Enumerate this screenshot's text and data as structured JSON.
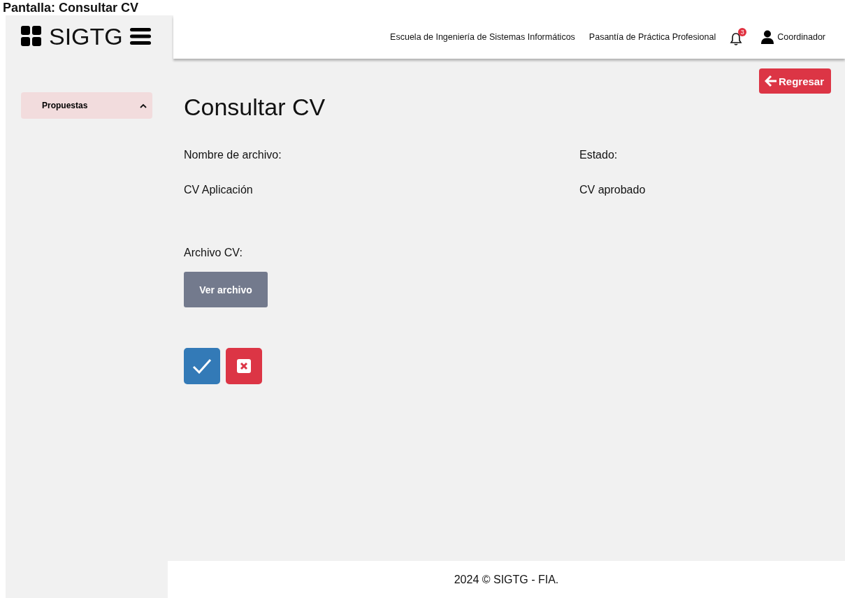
{
  "caption": "Pantalla: Consultar CV",
  "brand": {
    "name": "SIGTG"
  },
  "sidebar": {
    "items": [
      {
        "label": "Propuestas",
        "expanded": true
      }
    ]
  },
  "header": {
    "links": [
      "Escuela de Ingeniería de Sistemas Informáticos",
      "Pasantía de Práctica Profesional"
    ],
    "notification_count": "3",
    "user": "Coordinador"
  },
  "back_button": "Regresar",
  "title": "Consultar CV",
  "fields": [
    {
      "label": "Nombre de archivo:",
      "value": "CV Aplicación"
    },
    {
      "label": "Estado:",
      "value": "CV aprobado"
    }
  ],
  "file": {
    "label": "Archivo CV:",
    "button": "Ver archivo"
  },
  "footer": "2024 © SIGTG - FIA."
}
